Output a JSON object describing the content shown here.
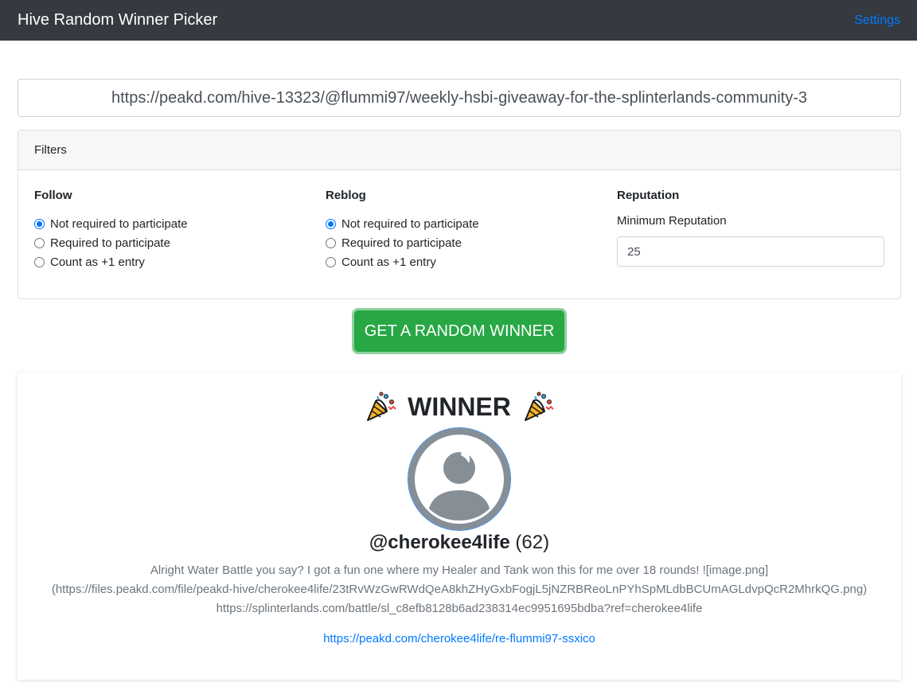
{
  "navbar": {
    "brand": "Hive Random Winner Picker",
    "settings_link": "Settings"
  },
  "post_url_input": {
    "value": "https://peakd.com/hive-13323/@flummi97/weekly-hsbi-giveaway-for-the-splinterlands-community-3"
  },
  "filters": {
    "header": "Filters",
    "follow": {
      "title": "Follow",
      "options": [
        "Not required to participate",
        "Required to participate",
        "Count as +1 entry"
      ],
      "selected": "Not required to participate"
    },
    "reblog": {
      "title": "Reblog",
      "options": [
        "Not required to participate",
        "Required to participate",
        "Count as +1 entry"
      ],
      "selected": "Not required to participate"
    },
    "reputation": {
      "title": "Reputation",
      "label": "Minimum Reputation",
      "value": "25"
    }
  },
  "action_button": "GET A RANDOM WINNER",
  "result": {
    "title": "WINNER",
    "title_icon": "party-popper-icon",
    "username": "@cherokee4life",
    "reputation": "(62)",
    "comment": "Alright Water Battle you say? I got a fun one where my Healer and Tank won this for me over 18 rounds! ![image.png]\n(https://files.peakd.com/file/peakd-hive/cherokee4life/23tRvWzGwRWdQeA8khZHyGxbFogjL5jNZRBReoLnPYhSpMLdbBCUmAGLdvpQcR2MhrkQG.png)\nhttps://splinterlands.com/battle/sl_c8efb8128b6ad238314ec9951695bdba?ref=cherokee4life",
    "comment_link": "https://peakd.com/cherokee4life/re-flummi97-ssxico"
  },
  "colors": {
    "navbar_bg": "#343a40",
    "link": "#007bff",
    "success": "#28a745",
    "radio_checked": "#0075ff"
  }
}
